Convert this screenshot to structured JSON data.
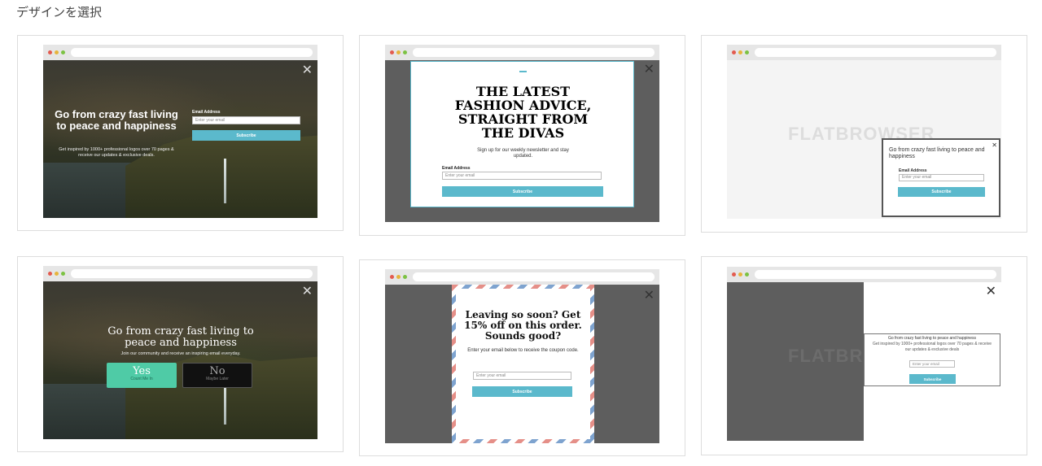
{
  "page": {
    "title": "デザインを選択"
  },
  "designs": {
    "d1": {
      "close": "✕",
      "headline": "Go from crazy fast living to peace and happiness",
      "subtext": "Get inspired by 1000+ professional logos over 70 pages & receive our updates & exclusive deals.",
      "email_label": "Email Address",
      "email_placeholder": "Enter your email",
      "button": "Subscribe"
    },
    "d2": {
      "close": "✕",
      "headline": "THE LATEST FASHION ADVICE, STRAIGHT FROM THE DIVAS",
      "subtext": "Sign up for our weekly newsletter and stay updated.",
      "email_label": "Email Address",
      "email_placeholder": "Enter your email",
      "button": "Subscribe"
    },
    "d3": {
      "watermark": "FLATBROWSER",
      "close": "✕",
      "headline": "Go from crazy fast living to peace and happiness",
      "email_label": "Email Address",
      "email_placeholder": "Enter your email",
      "button": "Subscribe"
    },
    "d4": {
      "close": "✕",
      "headline": "Go from crazy fast living to peace and happiness",
      "subtext": "Join our community and receive an inspiring email everyday.",
      "yes_label": "Yes",
      "yes_sub": "Count Me In",
      "no_label": "No",
      "no_sub": "Maybe Later"
    },
    "d5": {
      "close": "✕",
      "headline": "Leaving so soon? Get 15% off on this order. Sounds good?",
      "subtext": "Enter your email below to receive the coupon code.",
      "email_placeholder": "Enter your email",
      "button": "Subscribe"
    },
    "d6": {
      "watermark": "FLATBR",
      "close": "✕",
      "headline": "Go from crazy fast living to peace and happiness",
      "subtext": "Get inspired by 1000+ professional logos over 70 pages & receive our updates & exclusive deals",
      "email_placeholder": "Enter your email",
      "button": "Subscribe"
    }
  },
  "colors": {
    "accent": "#5bb9cc",
    "yes_green": "#4fcba6",
    "overlay_gray": "#5e5e5e"
  }
}
